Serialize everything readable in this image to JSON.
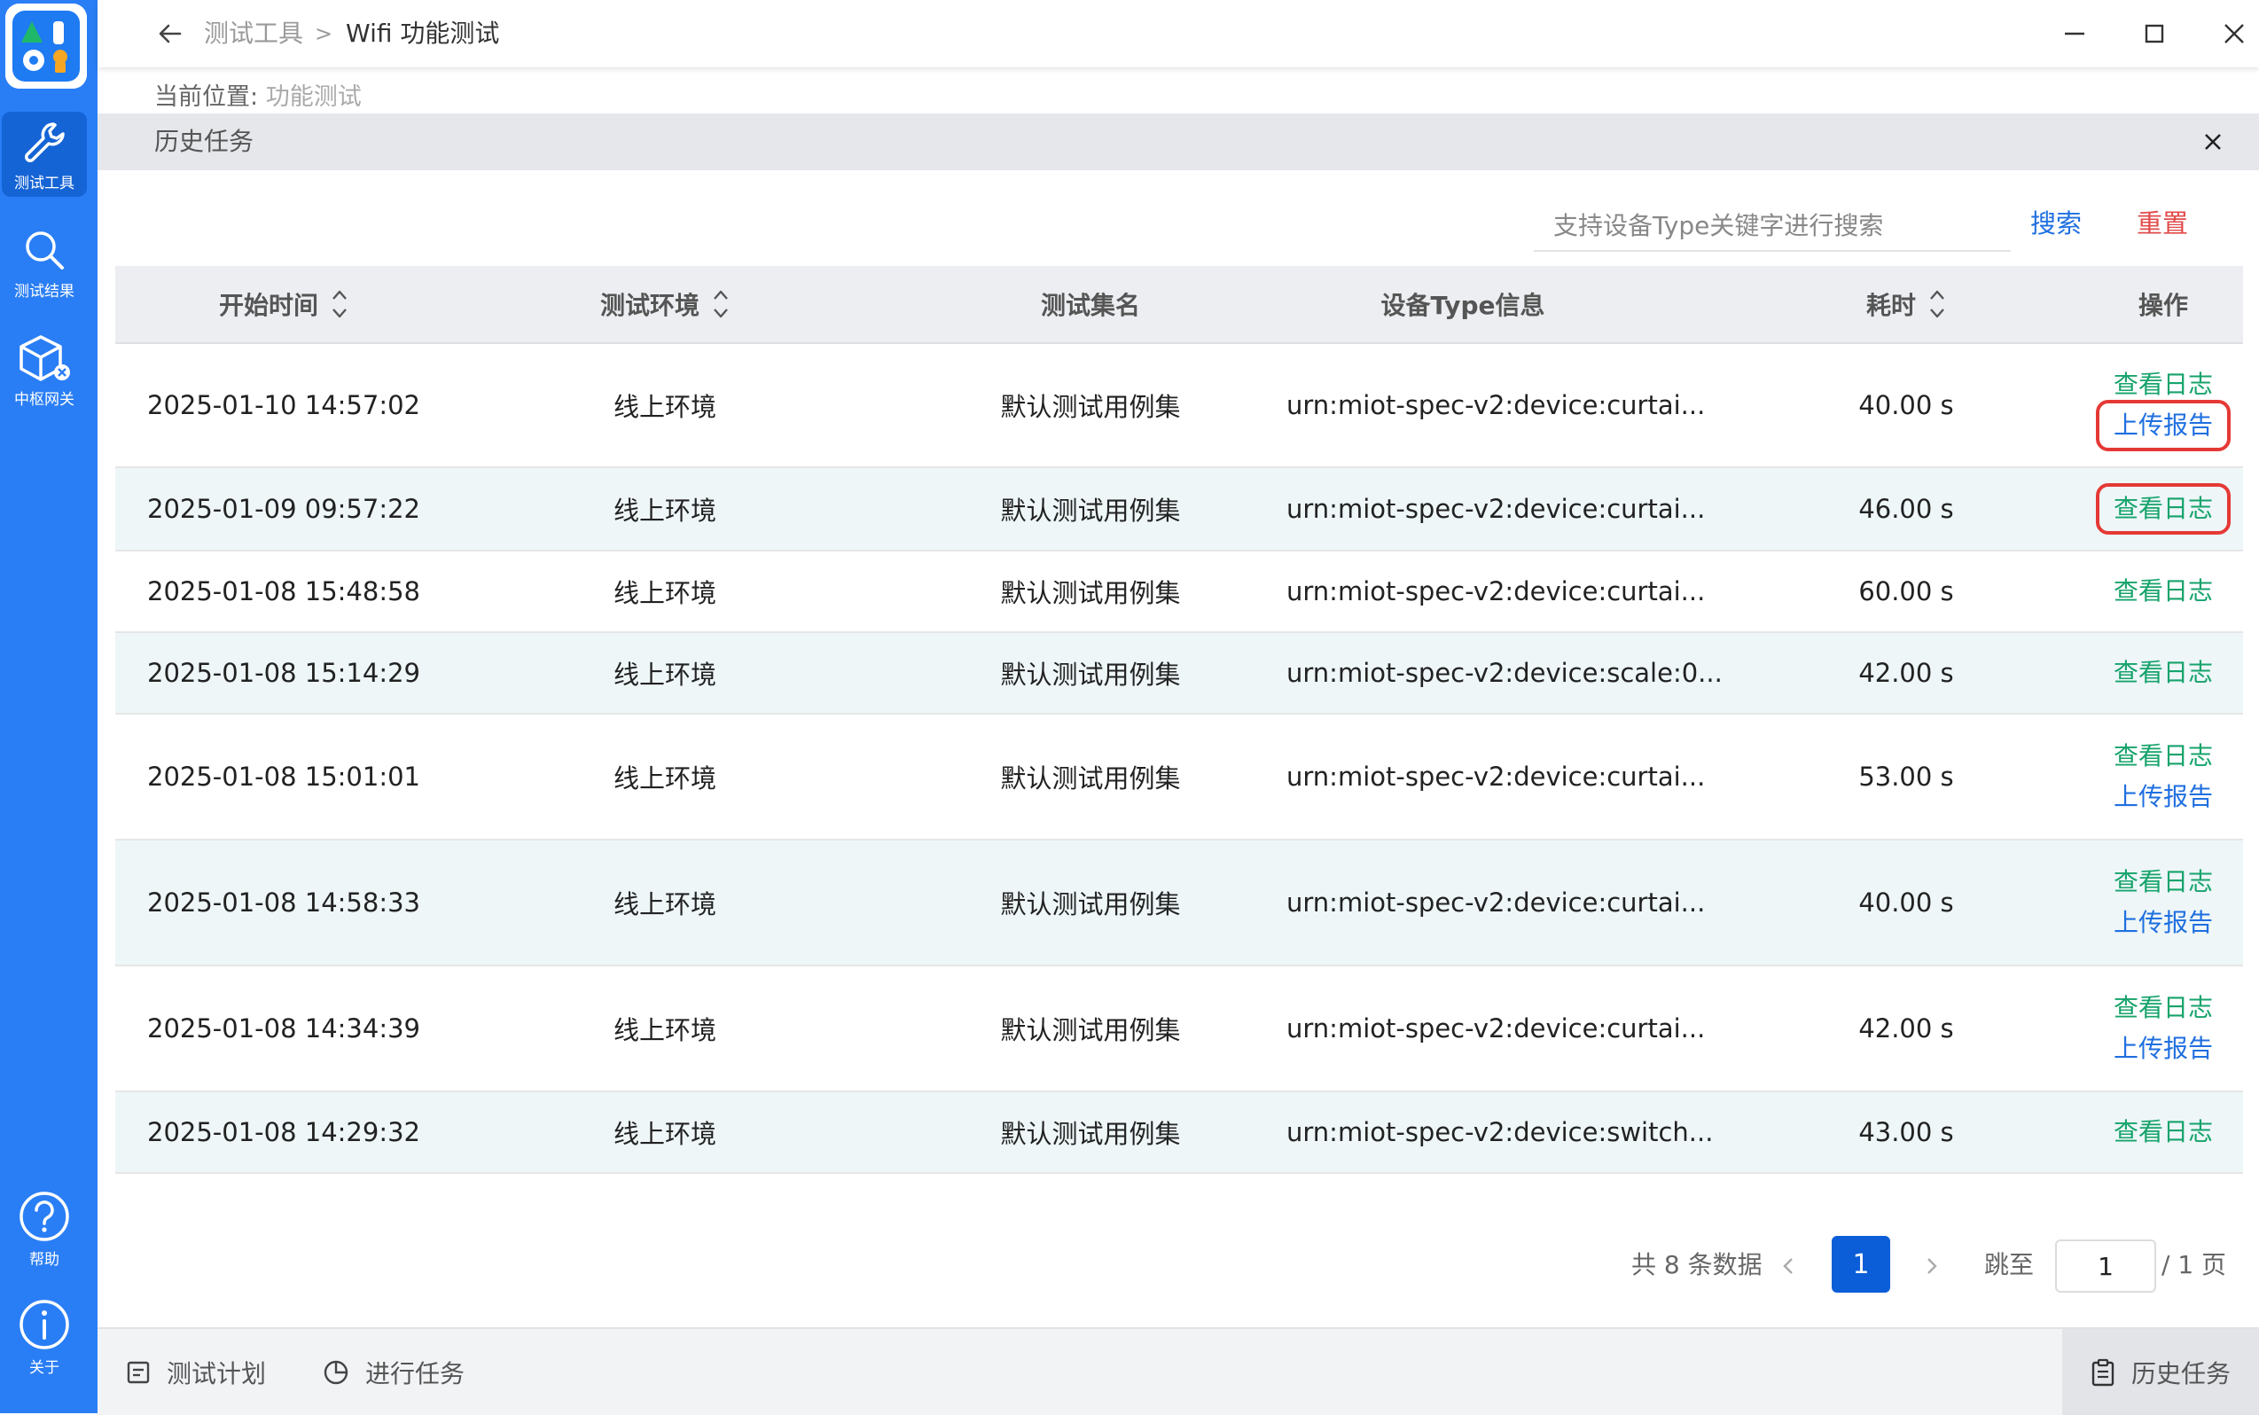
{
  "colors": {
    "sidebar": "#2a7ef5",
    "sidebar_active": "#1564d6",
    "link_green": "#16a36b",
    "link_blue": "#1f6fe0",
    "reset_red": "#e24a4a",
    "highlight_red": "#e53935",
    "page_active": "#0b5ed7"
  },
  "sidebar": {
    "logo_icon": "app-logo-icon",
    "items": [
      {
        "label": "测试工具",
        "icon": "wrench-icon",
        "active": true
      },
      {
        "label": "测试结果",
        "icon": "search-icon",
        "active": false
      },
      {
        "label": "中枢网关",
        "icon": "cube-icon",
        "active": false
      }
    ],
    "bottom_items": [
      {
        "label": "帮助",
        "icon": "help-icon"
      },
      {
        "label": "关于",
        "icon": "info-icon"
      }
    ]
  },
  "titlebar": {
    "breadcrumb_parent": "测试工具",
    "breadcrumb_separator": ">",
    "breadcrumb_current": "Wifi 功能测试"
  },
  "location": {
    "label": "当前位置:",
    "value": "功能测试"
  },
  "panel": {
    "title": "历史任务"
  },
  "search": {
    "placeholder": "支持设备Type关键字进行搜索",
    "search_label": "搜索",
    "reset_label": "重置"
  },
  "table": {
    "headers": {
      "start_time": "开始时间",
      "env": "测试环境",
      "suite": "测试集名",
      "device": "设备Type信息",
      "duration": "耗时",
      "actions": "操作"
    },
    "view_log_label": "查看日志",
    "upload_label": "上传报告",
    "rows": [
      {
        "start_time": "2025-01-10 14:57:02",
        "env": "线上环境",
        "suite": "默认测试用例集",
        "device": "urn:miot-spec-v2:device:curtai...",
        "duration": "40.00 s"
      },
      {
        "start_time": "2025-01-09 09:57:22",
        "env": "线上环境",
        "suite": "默认测试用例集",
        "device": "urn:miot-spec-v2:device:curtai...",
        "duration": "46.00 s"
      },
      {
        "start_time": "2025-01-08 15:48:58",
        "env": "线上环境",
        "suite": "默认测试用例集",
        "device": "urn:miot-spec-v2:device:curtai...",
        "duration": "60.00 s"
      },
      {
        "start_time": "2025-01-08 15:14:29",
        "env": "线上环境",
        "suite": "默认测试用例集",
        "device": "urn:miot-spec-v2:device:scale:0...",
        "duration": "42.00 s"
      },
      {
        "start_time": "2025-01-08 15:01:01",
        "env": "线上环境",
        "suite": "默认测试用例集",
        "device": "urn:miot-spec-v2:device:curtai...",
        "duration": "53.00 s"
      },
      {
        "start_time": "2025-01-08 14:58:33",
        "env": "线上环境",
        "suite": "默认测试用例集",
        "device": "urn:miot-spec-v2:device:curtai...",
        "duration": "40.00 s"
      },
      {
        "start_time": "2025-01-08 14:34:39",
        "env": "线上环境",
        "suite": "默认测试用例集",
        "device": "urn:miot-spec-v2:device:curtai...",
        "duration": "42.00 s"
      },
      {
        "start_time": "2025-01-08 14:29:32",
        "env": "线上环境",
        "suite": "默认测试用例集",
        "device": "urn:miot-spec-v2:device:switch...",
        "duration": "43.00 s"
      }
    ]
  },
  "pagination": {
    "total_text": "共 8 条数据",
    "current_page": "1",
    "jump_label": "跳至",
    "jump_value": "1",
    "total_pages_text": "/ 1 页"
  },
  "bottom_tabs": [
    {
      "label": "测试计划",
      "icon": "document-icon"
    },
    {
      "label": "进行任务",
      "icon": "clock-icon"
    },
    {
      "label": "历史任务",
      "icon": "clipboard-icon",
      "active": true
    }
  ]
}
